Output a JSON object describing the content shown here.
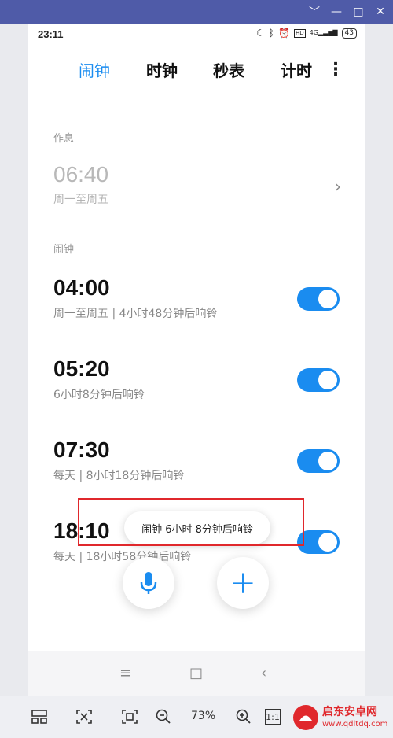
{
  "window": {
    "minimize": "—",
    "maximize": "□",
    "close": "✕",
    "collapse": "﹀"
  },
  "status": {
    "time": "23:11",
    "signal_label": "4G",
    "battery": "43"
  },
  "tabs": [
    "闹钟",
    "时钟",
    "秒表",
    "计时"
  ],
  "colors": {
    "accent": "#1a8cf0",
    "highlight_box": "#e0282c"
  },
  "sleep": {
    "section": "作息",
    "time": "06:40",
    "repeat": "周一至周五"
  },
  "alarm_section": "闹钟",
  "alarms": [
    {
      "time": "04:00",
      "sub": "周一至周五 | 4小时48分钟后响铃",
      "enabled": true
    },
    {
      "time": "05:20",
      "sub": "6小时8分钟后响铃",
      "enabled": true
    },
    {
      "time": "07:30",
      "sub": "每天 | 8小时18分钟后响铃",
      "enabled": true
    },
    {
      "time": "18:10",
      "sub": "每天 | 18小时58分钟后响铃",
      "enabled": true
    }
  ],
  "toast": "闹钟 6小时 8分钟后响铃",
  "toolbar": {
    "zoom": "73%",
    "actual_size": "1:1"
  },
  "watermark": {
    "name": "启东安卓网",
    "url": "www.qdltdq.com"
  }
}
